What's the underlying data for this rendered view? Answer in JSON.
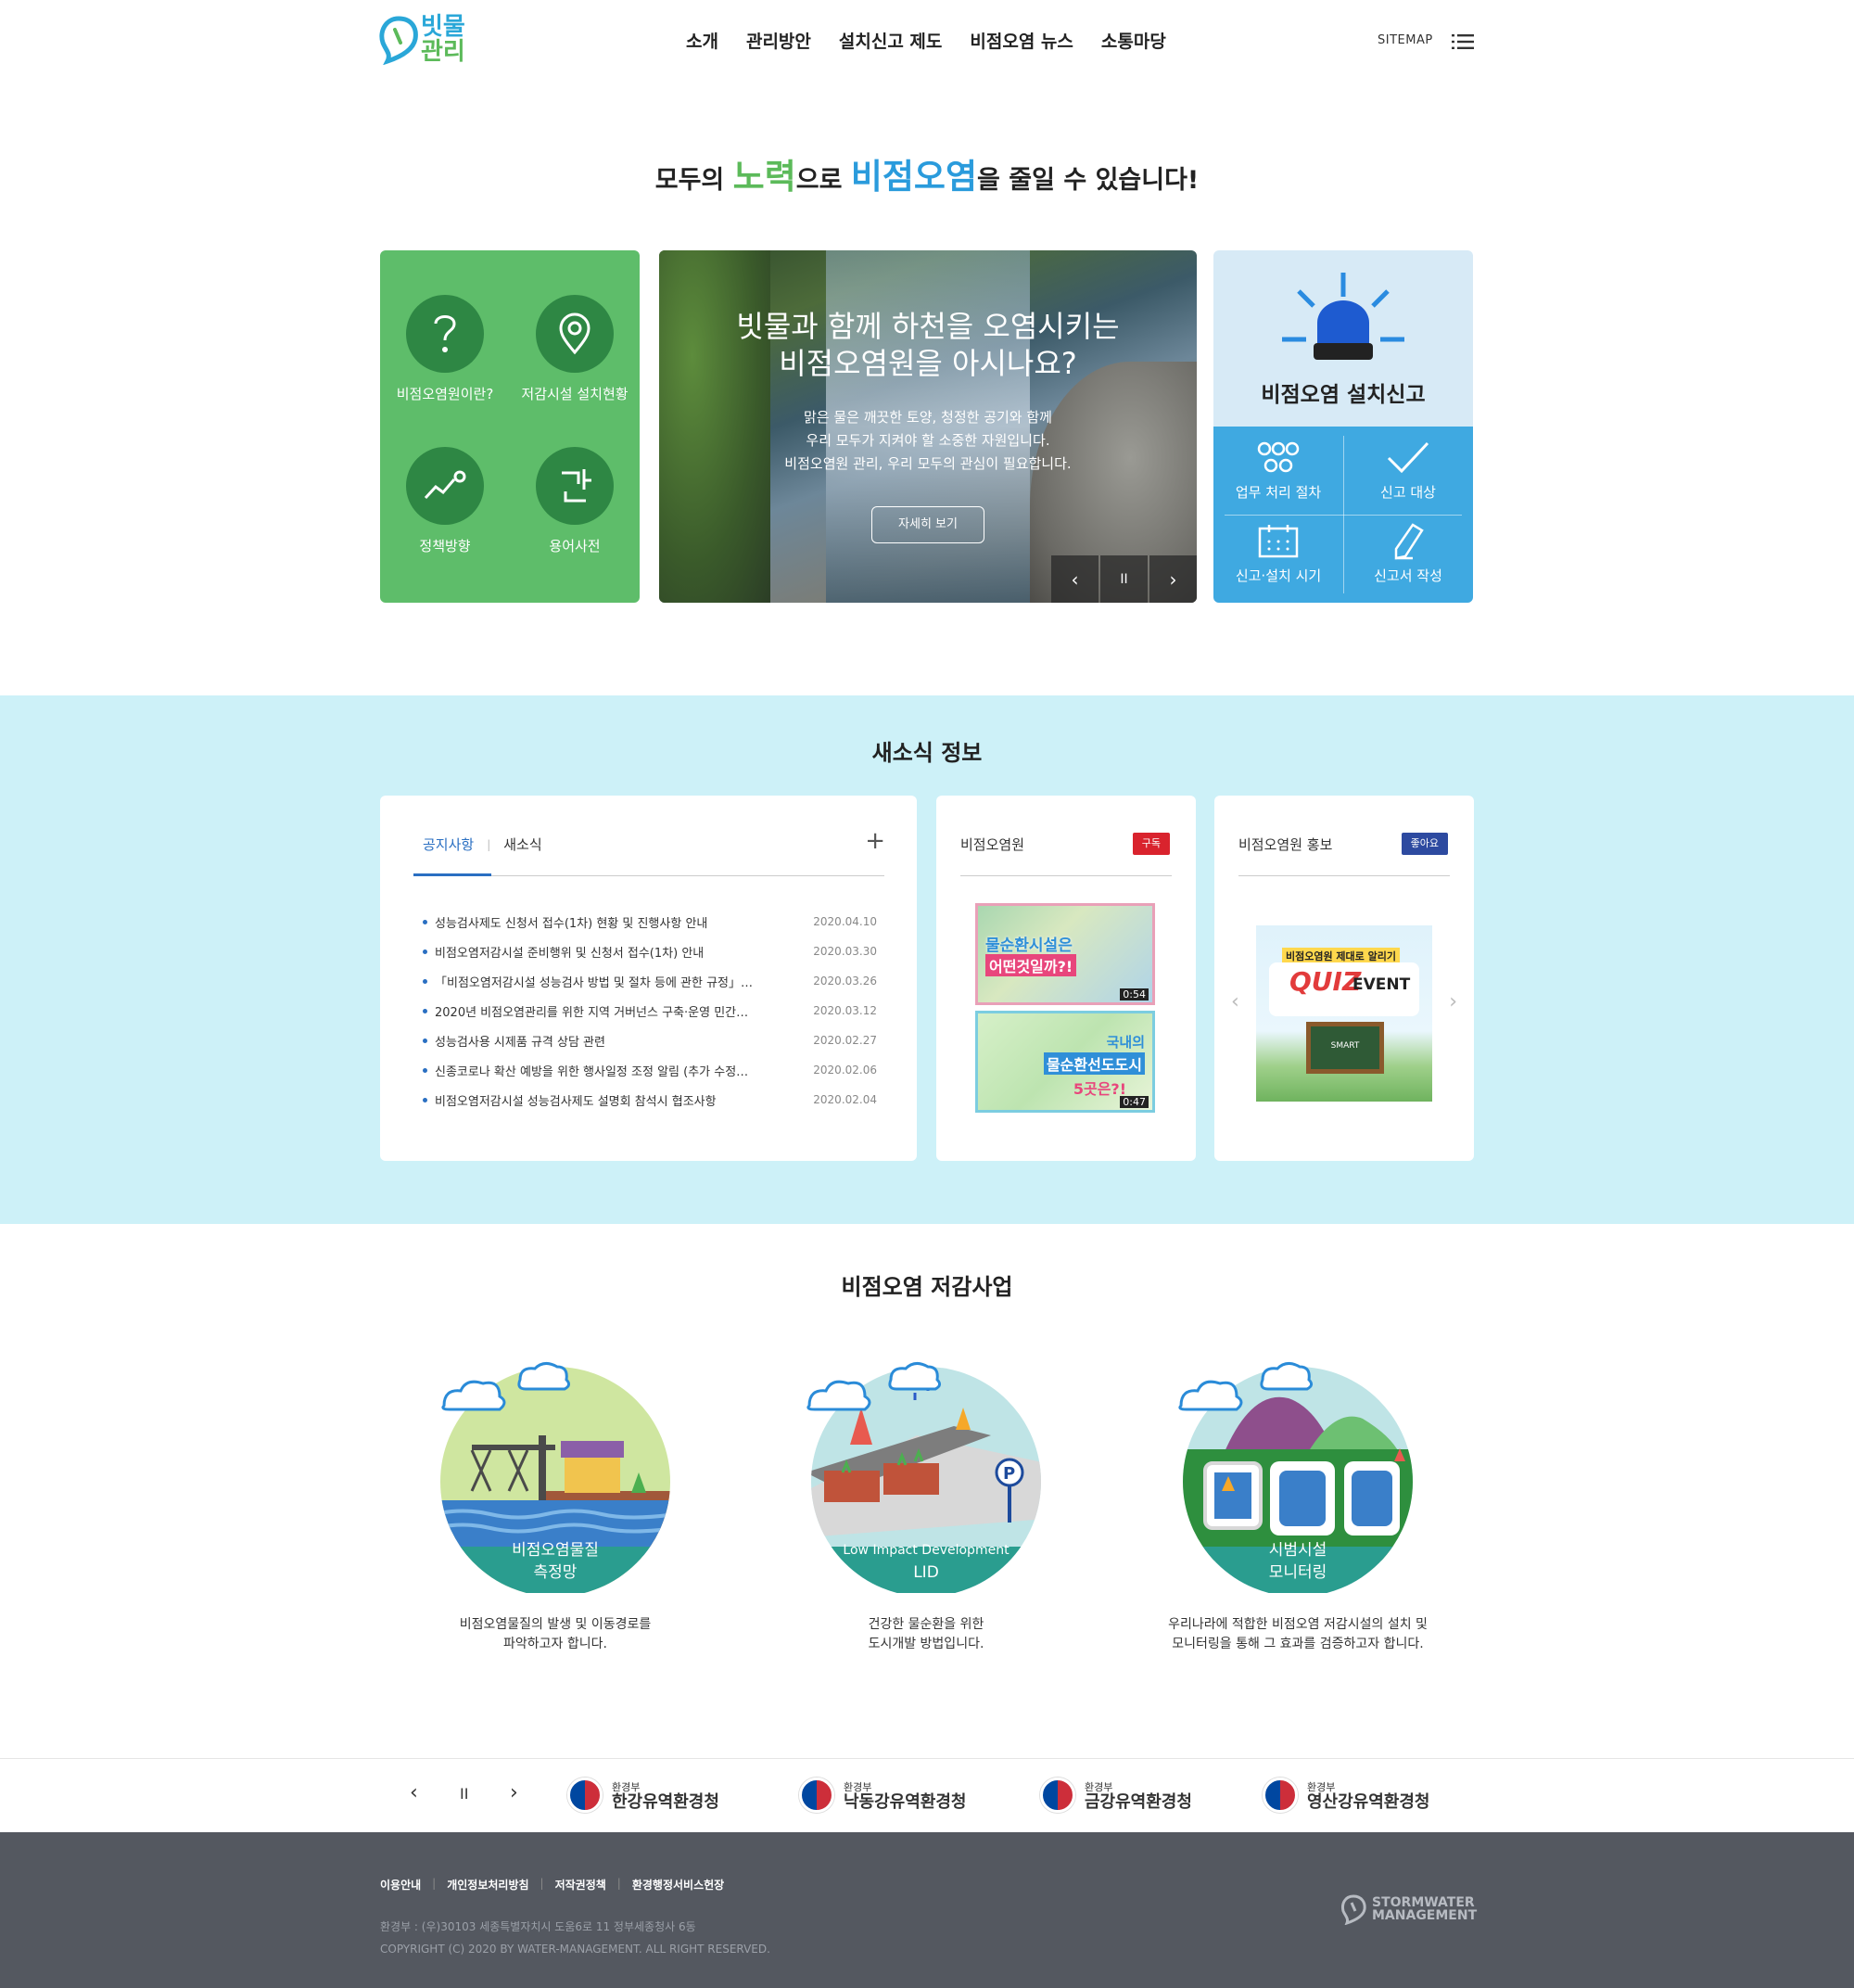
{
  "header": {
    "logo_line1": "빗물",
    "logo_line2": "관리",
    "nav": [
      "소개",
      "관리방안",
      "설치신고 제도",
      "비점오염 뉴스",
      "소통마당"
    ],
    "sitemap": "SITEMAP"
  },
  "hero": {
    "title_pre": "모두의 ",
    "title_green": "노력",
    "title_mid": "으로 ",
    "title_blue": "비점오염",
    "title_post": "을 줄일 수 있습니다!"
  },
  "quick_menu": {
    "items": [
      "비점오염원이란?",
      "저감시설 설치현황",
      "정책방향",
      "용어사전"
    ],
    "icon_char": "?",
    "dict_char": "ᄀᆫ"
  },
  "slide": {
    "heading_line1": "빗물과 함께 하천을 오염시키는",
    "heading_line2": "비점오염원을 아시나요?",
    "text_line1": "맑은 물은 깨끗한 토양, 청정한 공기와 함께",
    "text_line2": "우리 모두가 지켜야 할 소중한 자원입니다.",
    "text_line3": "비점오염원 관리, 우리 모두의 관심이 필요합니다.",
    "button": "자세히 보기",
    "prev": "‹",
    "pause": "II",
    "next": "›"
  },
  "report": {
    "title": "비점오염 설치신고",
    "items": [
      "업무 처리 절차",
      "신고 대상",
      "신고·설치 시기",
      "신고서 작성"
    ]
  },
  "news": {
    "section_title": "새소식 정보",
    "tab_active": "공지사항",
    "tab_inactive": "새소식",
    "more": "+",
    "items": [
      {
        "title": "성능검사제도 신청서 접수(1차) 현황 및 진행사항 안내",
        "date": "2020.04.10"
      },
      {
        "title": "비점오염저감시설 준비행위 및 신청서 접수(1차) 안내",
        "date": "2020.03.30"
      },
      {
        "title": "「비점오염저감시설 성능검사 방법 및 절차 등에 관한 규정」…",
        "date": "2020.03.26"
      },
      {
        "title": "2020년 비점오염관리를 위한 지역 거버넌스 구축·운영 민간…",
        "date": "2020.03.12"
      },
      {
        "title": "성능검사용 시제품 규격 상담 관련",
        "date": "2020.02.27"
      },
      {
        "title": "신종코로나 확산 예방을 위한 행사일정 조정 알림 (추가 수정…",
        "date": "2020.02.06"
      },
      {
        "title": "비점오염저감시설 성능검사제도 설명회 참석시 협조사항",
        "date": "2020.02.04"
      }
    ],
    "video_card": {
      "title": "비점오염원",
      "badge": "구독",
      "video1_text": "물순환시설은",
      "video1_text2": "어떤것일까?!",
      "video1_time": "0:54",
      "video2_text": "국내의",
      "video2_text2": "물순환선도도시",
      "video2_text3": "5곳은?!",
      "video2_time": "0:47"
    },
    "promo_card": {
      "title": "비점오염원 홍보",
      "badge": "좋아요",
      "banner_top": "비점오염원 제대로 알리기",
      "banner_quiz": "QUIZ",
      "banner_event": "EVENT",
      "board_text": "SMART"
    }
  },
  "reduction": {
    "section_title": "비점오염 저감사업",
    "items": [
      {
        "cap1": "비점오염물질",
        "cap2": "측정망",
        "desc1": "비점오염물질의 발생 및 이동경로를",
        "desc2": "파악하고자 합니다."
      },
      {
        "cap1": "Low Impact Development",
        "cap2": "LID",
        "desc1": "건강한 물순환을 위한",
        "desc2": "도시개발 방법입니다."
      },
      {
        "cap1": "시범시설",
        "cap2": "모니터링",
        "desc1": "우리나라에 적합한 비점오염 저감시설의 설치 및",
        "desc2": "모니터링을 통해 그 효과를 검증하고자 합니다."
      }
    ]
  },
  "partners": {
    "prev": "‹",
    "pause": "II",
    "next": "›",
    "orgs": [
      {
        "sub": "환경부",
        "name": "한강유역환경청"
      },
      {
        "sub": "환경부",
        "name": "낙동강유역환경청"
      },
      {
        "sub": "환경부",
        "name": "금강유역환경청"
      },
      {
        "sub": "환경부",
        "name": "영산강유역환경청"
      }
    ]
  },
  "footer": {
    "links": [
      "이용안내",
      "개인정보처리방침",
      "저작권정책",
      "환경행정서비스헌장"
    ],
    "address": "환경부 : (우)30103 세종특별자치시 도움6로 11 정부세종청사 6동",
    "copyright": "COPYRIGHT (C) 2020 BY WATER-MANAGEMENT. ALL RIGHT RESERVED.",
    "logo_line1": "STORMWATER",
    "logo_line2": "MANAGEMENT"
  },
  "colors": {
    "green": "#5ebd6a",
    "blue": "#3fa9e1",
    "news_bg": "#cdf1f8",
    "footer_bg": "#545860",
    "teal": "#2a9d8f"
  }
}
